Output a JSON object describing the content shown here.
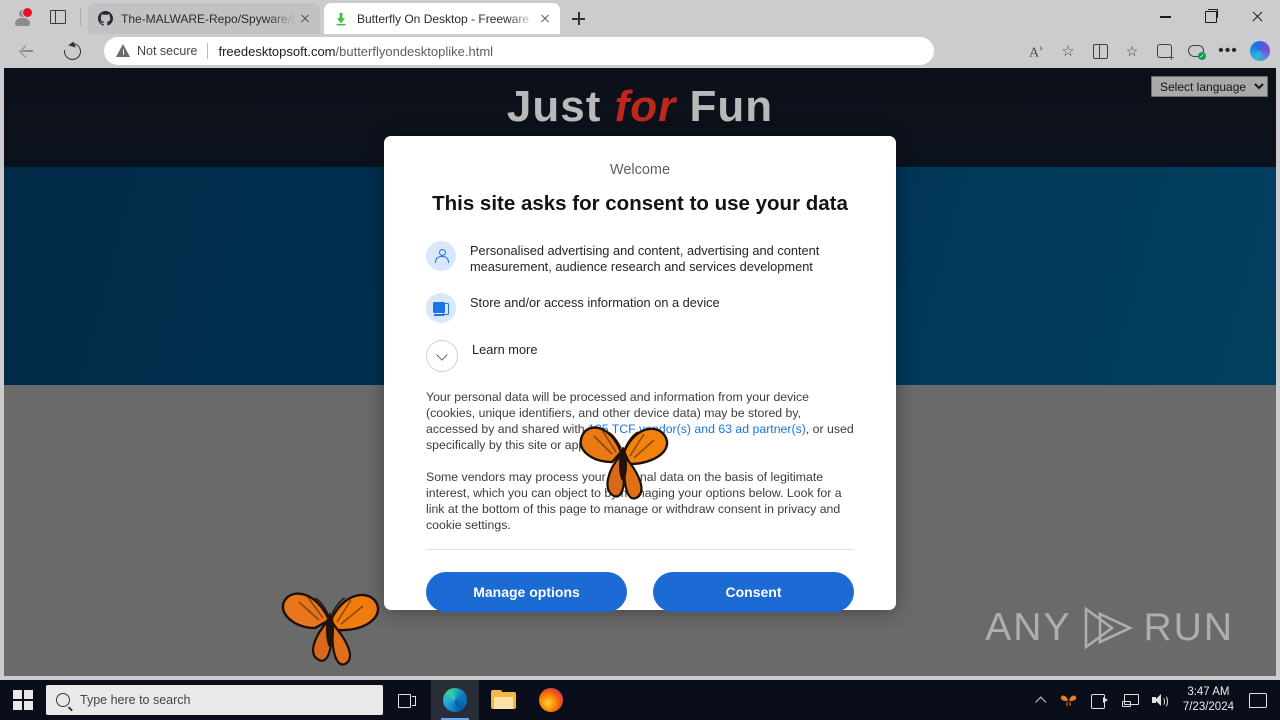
{
  "browser": {
    "profile_badge": "notification-dot",
    "tabs": [
      {
        "title": "The-MALWARE-Repo/Spyware/b",
        "favicon": "github-icon",
        "active": false
      },
      {
        "title": "Butterfly On Desktop - Freeware",
        "favicon": "download-arrow-icon",
        "active": true
      }
    ],
    "new_tab_label": "+",
    "window_controls": [
      "minimize",
      "maximize",
      "close"
    ],
    "toolbar": {
      "back": "back-arrow-icon",
      "refresh": "reload-icon",
      "security_label": "Not secure",
      "url_host": "freedesktopsoft.com",
      "url_path": "/butterflyondesktoplike.html",
      "right_icons": [
        "read-aloud-icon",
        "favorite-star-icon",
        "split-screen-icon",
        "collections-icon",
        "tab-group-icon",
        "browser-essentials-icon",
        "settings-ellipsis-icon",
        "copilot-icon"
      ]
    }
  },
  "page": {
    "hero_title_part1": "Just ",
    "hero_title_part2": "for ",
    "hero_title_part3": "Fun",
    "language_select": "Select language",
    "language_options": [
      "Select language"
    ],
    "watermark": {
      "left": "ANY",
      "right": "RUN"
    }
  },
  "dialog": {
    "welcome": "Welcome",
    "title": "This site asks for consent to use your data",
    "purposes": [
      {
        "icon": "person-icon",
        "text": "Personalised advertising and content, advertising and content measurement, audience research and services development"
      },
      {
        "icon": "device-icon",
        "text": "Store and/or access information on a device"
      },
      {
        "icon": "chevron-down-icon",
        "text": "Learn more"
      }
    ],
    "paragraph1_before": "Your personal data will be processed and information from your device (cookies, unique identifiers, and other device data) may be stored by, accessed by and shared with ",
    "paragraph1_link": "135 TCF vendor(s) and 63 ad partner(s)",
    "paragraph1_after": ", or used specifically by this site or app.",
    "paragraph2": "Some vendors may process your personal data on the basis of legitimate interest, which you can object to by managing your options below. Look for a link at the bottom of this page to manage or withdraw consent in privacy and cookie settings.",
    "manage_options_label": "Manage options",
    "consent_label": "Consent"
  },
  "taskbar": {
    "start": "windows-start-icon",
    "search_placeholder": "Type here to search",
    "task_view": "task-view-icon",
    "apps": [
      {
        "name": "edge-taskbar-icon",
        "active": true
      },
      {
        "name": "file-explorer-taskbar-icon",
        "active": false
      },
      {
        "name": "firefox-taskbar-icon",
        "active": false
      }
    ],
    "tray_icons": [
      "show-hidden-icons-chevron",
      "butterfly-tray-icon",
      "camera-icon",
      "network-icon",
      "volume-icon"
    ],
    "time": "3:47 AM",
    "date": "7/23/2024",
    "action_center": "action-center-icon"
  }
}
